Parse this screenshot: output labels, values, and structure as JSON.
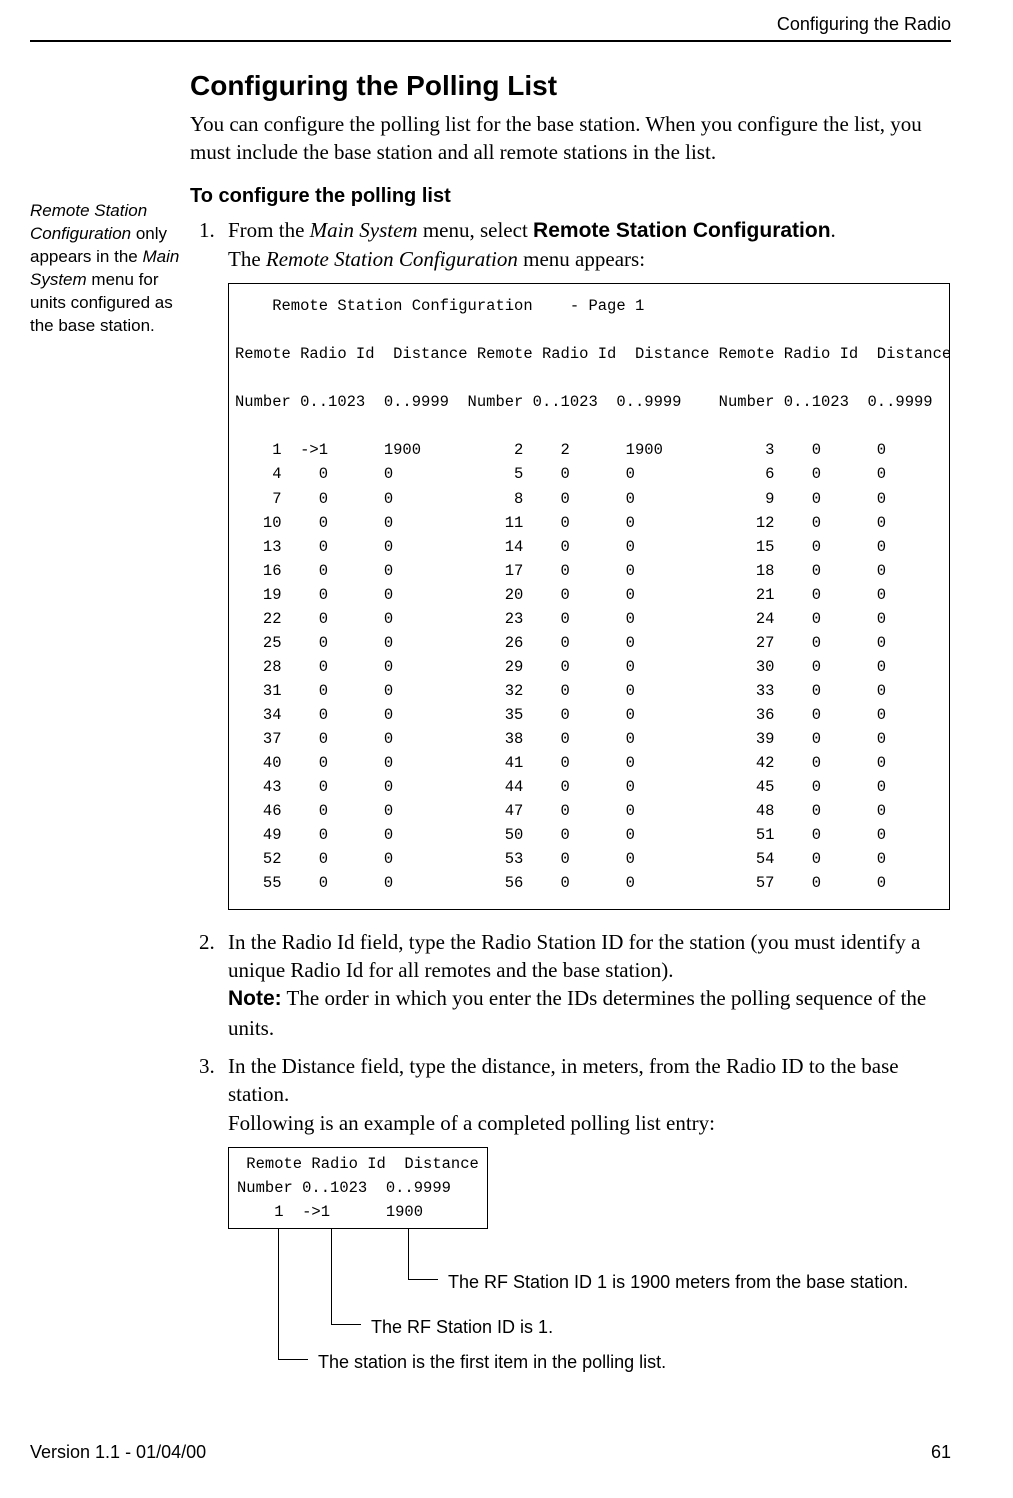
{
  "header": {
    "running": "Configuring the Radio"
  },
  "margin_note": {
    "line1_ital": "Remote Station Configuration",
    "line1_rest": " only appears in the ",
    "line1_ital2": "Main System",
    "line1_rest2": " menu for units configured as the base station."
  },
  "section": {
    "title": "Configuring the Polling List",
    "intro": "You can configure the polling list for the base station. When you configure the list, you must include the base station and all remote stations in the list.",
    "proc_heading": "To configure the polling list"
  },
  "steps": {
    "s1a": "From the ",
    "s1_mi": "Main System",
    "s1b": " menu, select ",
    "s1_bold": "Remote Station Configuration",
    "s1c": ".",
    "s1d_a": "The ",
    "s1d_mi": "Remote Station Configuration",
    "s1d_b": " menu appears:",
    "s2a": "In the Radio Id field, type the Radio Station ID for the station (you must identify a unique Radio Id for all remotes and the base station).",
    "s2_note_label": "Note:",
    "s2_note": " The order in which you enter the IDs determines the polling sequence of the units.",
    "s3a": "In the Distance field, type the distance, in meters, from the Radio ID to the base station.",
    "s3b": "Following is an example of a completed polling list entry:"
  },
  "screen": {
    "text": "    Remote Station Configuration    - Page 1\n\nRemote Radio Id  Distance Remote Radio Id  Distance Remote Radio Id  Distance\n\nNumber 0..1023  0..9999  Number 0..1023  0..9999    Number 0..1023  0..9999\n\n    1  ->1      1900          2    2      1900           3    0      0\n    4    0      0             5    0      0              6    0      0\n    7    0      0             8    0      0              9    0      0\n   10    0      0            11    0      0             12    0      0\n   13    0      0            14    0      0             15    0      0\n   16    0      0            17    0      0             18    0      0\n   19    0      0            20    0      0             21    0      0\n   22    0      0            23    0      0             24    0      0\n   25    0      0            26    0      0             27    0      0\n   28    0      0            29    0      0             30    0      0\n   31    0      0            32    0      0             33    0      0\n   34    0      0            35    0      0             36    0      0\n   37    0      0            38    0      0             39    0      0\n   40    0      0            41    0      0             42    0      0\n   43    0      0            44    0      0             45    0      0\n   46    0      0            47    0      0             48    0      0\n   49    0      0            50    0      0             51    0      0\n   52    0      0            53    0      0             54    0      0\n   55    0      0            56    0      0             57    0      0"
  },
  "example": {
    "text": " Remote Radio Id  Distance\nNumber 0..1023  0..9999\n    1  ->1      1900"
  },
  "callouts": {
    "c1": "The RF Station ID 1 is 1900 meters from the base station.",
    "c2": "The RF Station ID is 1.",
    "c3": "The station is the first item in the polling list."
  },
  "footer": {
    "version": "Version 1.1 - 01/04/00",
    "page": "61"
  }
}
